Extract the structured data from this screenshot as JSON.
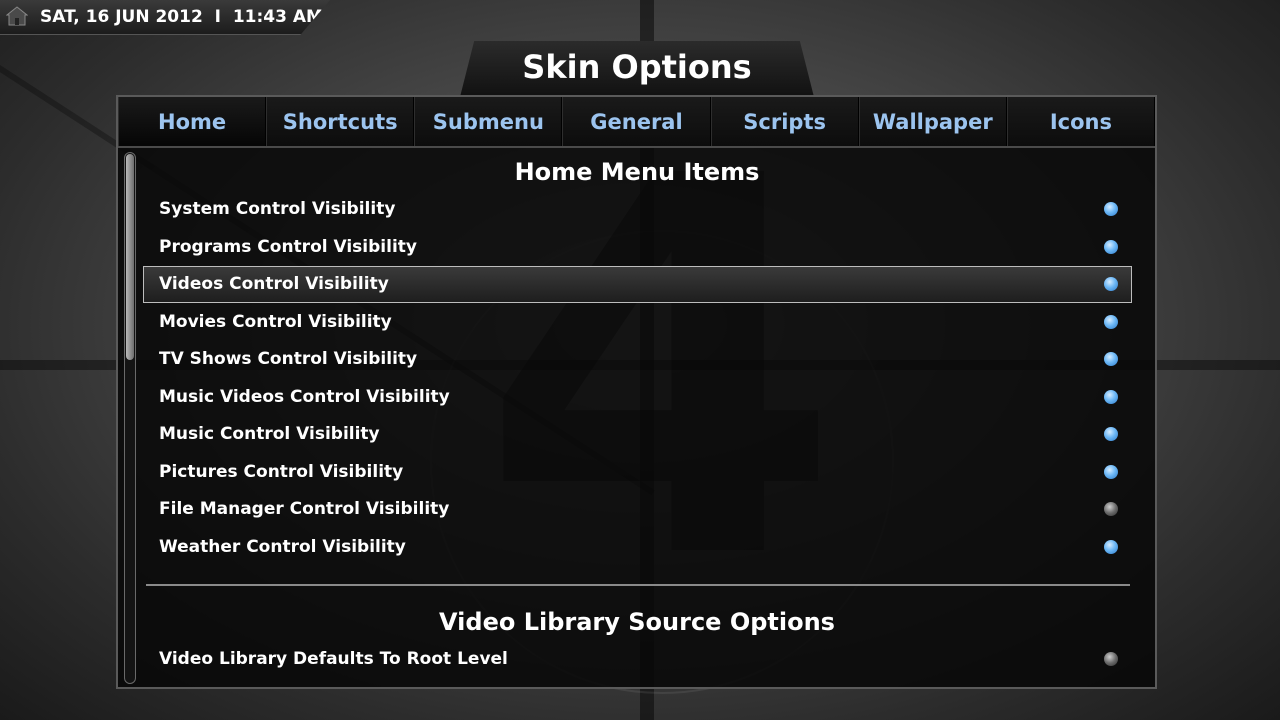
{
  "datebar": {
    "date": "SAT, 16 JUN 2012",
    "separator": "I",
    "time": "11:43 AM",
    "icon": "home-icon"
  },
  "title": "Skin Options",
  "colors": {
    "tab_text": "#9cc4ef",
    "dot_on": "#6db8f6",
    "dot_off": "#6b6b6b"
  },
  "tabs": [
    {
      "label": "Home"
    },
    {
      "label": "Shortcuts"
    },
    {
      "label": "Submenu"
    },
    {
      "label": "General"
    },
    {
      "label": "Scripts"
    },
    {
      "label": "Wallpaper"
    },
    {
      "label": "Icons"
    }
  ],
  "sections": {
    "home_menu": {
      "header": "Home Menu Items",
      "items": [
        {
          "label": "System Control Visibility",
          "enabled": true
        },
        {
          "label": "Programs Control Visibility",
          "enabled": true
        },
        {
          "label": "Videos Control Visibility",
          "enabled": true,
          "focused": true
        },
        {
          "label": "Movies Control Visibility",
          "enabled": true
        },
        {
          "label": "TV Shows Control Visibility",
          "enabled": true
        },
        {
          "label": "Music Videos Control Visibility",
          "enabled": true
        },
        {
          "label": "Music Control Visibility",
          "enabled": true
        },
        {
          "label": "Pictures Control Visibility",
          "enabled": true
        },
        {
          "label": "File Manager Control Visibility",
          "enabled": false
        },
        {
          "label": "Weather Control Visibility",
          "enabled": true
        }
      ]
    },
    "video_library": {
      "header": "Video Library Source Options",
      "items": [
        {
          "label": "Video Library Defaults To Root Level",
          "enabled": false
        }
      ]
    }
  }
}
